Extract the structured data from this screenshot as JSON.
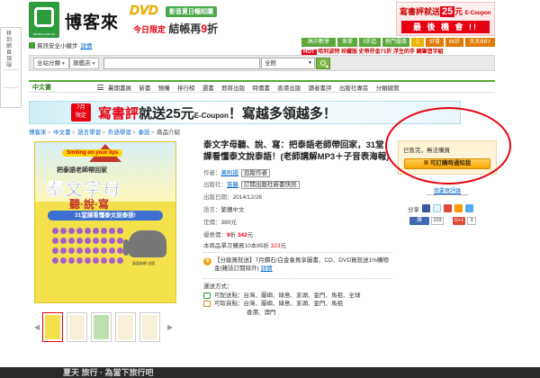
{
  "left_strip": {
    "text": "移到網頁頂端"
  },
  "header": {
    "logo_text": "博客來",
    "logo_url": "books.com.tw",
    "dvd_banner": {
      "dvd": "DVD",
      "tag": "影音夏日暢知購",
      "line2_prefix": "今日限定",
      "line2_main": "結帳再",
      "line2_num": "9",
      "line2_suffix": "折"
    },
    "review_banner": {
      "l1_text": "寫書評就送",
      "l1_num": "25",
      "l1_unit": "元",
      "l1_ec": "E-Coupon",
      "l2": "最 後 機 會 !!"
    }
  },
  "security": {
    "text": "資訊安全小撇步",
    "link": "詳情"
  },
  "top_nav": {
    "tabs": [
      "高中數學",
      "車豪",
      "5折起",
      "熱門優惠",
      "上"
    ],
    "right_tabs": [
      "好書",
      "66折",
      "天天BBY"
    ]
  },
  "promo_strip": {
    "hot": "HOT",
    "text": "哈利波特 珍藏版 史帝芬金71折 浮生的手 鋼筆習字組"
  },
  "search": {
    "category_btn": "全站分類",
    "flagship_btn": "旗艦店",
    "placeholder": "",
    "scope": "全館"
  },
  "category_nav": {
    "home": "中文書",
    "items": [
      "暑期書展",
      "新書",
      "預購",
      "排行榜",
      "選書",
      "即將出版",
      "特價書",
      "香港出版",
      "讀者書評",
      "出版社專區",
      "分類總覽"
    ]
  },
  "wide_banner": {
    "badge_top": "7月",
    "badge_bottom": "限定",
    "pink": "寫書評",
    "main": "就送25元",
    "ec": "E-Coupon",
    "tail": "！寫越多領越多！"
  },
  "breadcrumb": [
    "博客來",
    "中文書",
    "語言學習",
    "外語學習",
    "泰語",
    "商品介紹"
  ],
  "cover": {
    "pill": "Smiling on your lips",
    "sub": "把泰語老師帶回家",
    "title": "泰文字母",
    "title2": "聽·說·寫",
    "ribbon": "31堂課看懂泰文說泰語!",
    "pub": "泰語老師 出版"
  },
  "book": {
    "title": "泰文字母聽、說、寫：把泰語老師帶回家，31堂課看懂泰文說泰語！(老師講解MP3＋子音表海報)",
    "author_label": "作者：",
    "author": "黃則揚",
    "author_follow": "追蹤作者",
    "publisher_label": "出版社：",
    "publisher": "笛藤",
    "publisher_follow": "訂閱出版社新書快訊",
    "date_label": "出版日期：",
    "date": "2014/12/26",
    "lang_label": "語言：",
    "lang": "繁體中文",
    "list_label": "定價：",
    "list_price": "380元",
    "sale_label": "優惠價：",
    "sale_discount": "9",
    "sale_unit": "折",
    "sale_price": "342",
    "sale_price_unit": "元",
    "max_label": "本商品單次購買10本85折",
    "max_price": "323",
    "max_unit": "元",
    "promo_text": "【分級買就送】7月鑽石/白金會員享圖書、CD、DVD買就送1%購物金(雜誌訂閱除外)",
    "promo_link": "詳情",
    "delivery_title": "運送方式：",
    "ship_label": "可配送點：",
    "ship_areas": "台灣、蘭嶼、綠島、澎湖、金門、馬祖、全球",
    "pick_label": "可取貨點：",
    "pick_areas_1": "台灣、蘭嶼、綠島、澎湖、金門、馬祖",
    "pick_areas_2": "香港、澳門"
  },
  "sidebar": {
    "stock_status": "已售完，無法購買",
    "notify_label": "可訂購時通知我",
    "review_link": "我要寫評論",
    "share_label": "分享",
    "fb_like": "讚",
    "fb_count": "103",
    "gplus": "G+1",
    "gplus_count": "3"
  },
  "colors": {
    "brand_green": "#2e9b3c",
    "accent_red": "#e60012",
    "link_blue": "#0066cc",
    "button_orange": "#f6a800"
  },
  "footer_text": "夏天 旅行 · 為當下旅行吧"
}
